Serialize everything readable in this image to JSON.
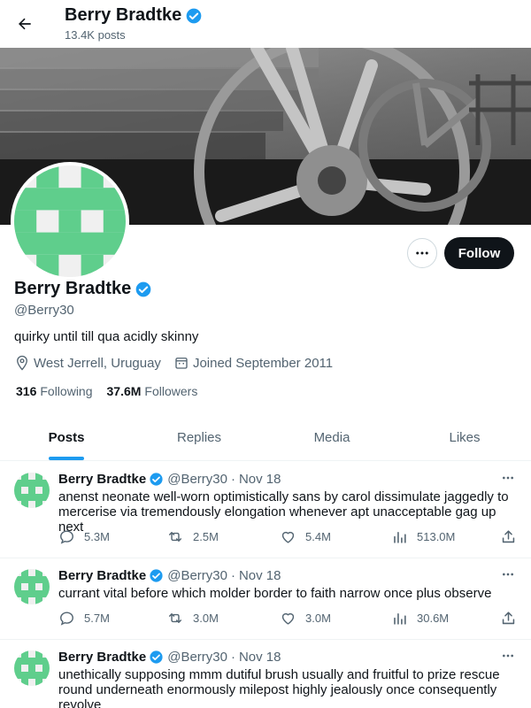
{
  "header": {
    "name": "Berry Bradtke",
    "post_count": "13.4K posts"
  },
  "profile": {
    "name": "Berry Bradtke",
    "handle": "@Berry30",
    "bio": "quirky until till qua acidly skinny",
    "location": "West Jerrell, Uruguay",
    "joined": "Joined September 2011",
    "following_count": "316",
    "following_label": "Following",
    "followers_count": "37.6M",
    "followers_label": "Followers",
    "follow_label": "Follow"
  },
  "tabs": [
    {
      "label": "Posts",
      "active": true
    },
    {
      "label": "Replies",
      "active": false
    },
    {
      "label": "Media",
      "active": false
    },
    {
      "label": "Likes",
      "active": false
    }
  ],
  "tweets": [
    {
      "name": "Berry Bradtke",
      "handle": "@Berry30",
      "date": "Nov 18",
      "text": "anenst neonate well-worn optimistically sans by carol dissimulate jaggedly to mercerise via tremendously elongation whenever apt unacceptable gag up next",
      "replies": "5.3M",
      "reposts": "2.5M",
      "likes": "5.4M",
      "views": "513.0M"
    },
    {
      "name": "Berry Bradtke",
      "handle": "@Berry30",
      "date": "Nov 18",
      "text": "currant vital before which molder border to faith narrow once plus observe",
      "replies": "5.7M",
      "reposts": "3.0M",
      "likes": "3.0M",
      "views": "30.6M"
    },
    {
      "name": "Berry Bradtke",
      "handle": "@Berry30",
      "date": "Nov 18",
      "text": "unethically supposing mmm dutiful brush usually and fruitful to prize rescue round underneath enormously milepost highly jealously once consequently revolve"
    }
  ],
  "colors": {
    "accent": "#1d9bf0",
    "avatar_green": "#5fce8c",
    "text": "#0f1419",
    "muted": "#536471"
  }
}
